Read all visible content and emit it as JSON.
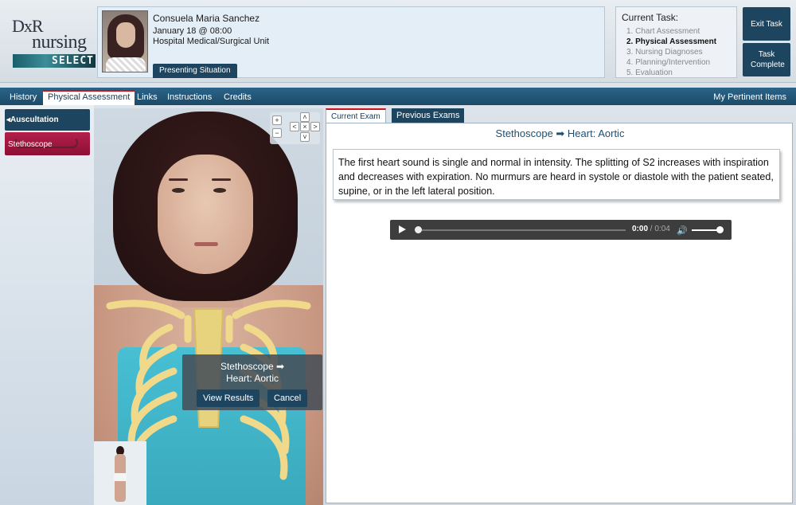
{
  "logo": {
    "line1": "DxR",
    "line2": "nursing",
    "line3": "SELECT"
  },
  "patient": {
    "name": "Consuela Maria Sanchez",
    "date": "January 18 @ 08:00",
    "unit": "Hospital Medical/Surgical Unit",
    "presenting_label": "Presenting Situation"
  },
  "task": {
    "title": "Current Task:",
    "items": [
      {
        "label": "1. Chart Assessment",
        "active": false
      },
      {
        "label": "2. Physical Assessment",
        "active": true
      },
      {
        "label": "3. Nursing Diagnoses",
        "active": false
      },
      {
        "label": "4. Planning/Intervention",
        "active": false
      },
      {
        "label": "5. Evaluation",
        "active": false
      }
    ],
    "exit_label": "Exit Task",
    "complete_label": "Task Complete"
  },
  "nav": {
    "tabs": [
      "History",
      "Physical Assessment",
      "Links",
      "Instructions",
      "Credits"
    ],
    "active": "Physical Assessment",
    "right_label": "My Pertinent Items"
  },
  "left": {
    "auscultation_label": "Auscultation",
    "stethoscope_label": "Stethoscope"
  },
  "viewer": {
    "zoom_in": "+",
    "zoom_out": "−",
    "pan_up": "˄",
    "pan_down": "˅",
    "pan_left": "<",
    "pan_right": ">",
    "reset": "×",
    "popup_line1": "Stethoscope ➡",
    "popup_line2": "Heart: Aortic",
    "view_results_label": "View Results",
    "cancel_label": "Cancel"
  },
  "exam": {
    "tab_current": "Current Exam",
    "tab_previous": "Previous Exams",
    "title": "Stethoscope ➡ Heart: Aortic",
    "findings": "The first heart sound is single and normal in intensity. The splitting of S2 increases with inspiration and decreases with expiration. No murmurs are heard in systole or diastole with the patient seated, supine, or in the left lateral position.",
    "audio": {
      "current": "0:00",
      "separator": " / ",
      "duration": "0:04",
      "progress": 0.0,
      "volume": 1.0
    }
  },
  "colors": {
    "nav_bg": "#1c4a68",
    "button_bg": "#1d4560",
    "accent_red": "#c4161c",
    "cloth": "#48bfd3"
  }
}
